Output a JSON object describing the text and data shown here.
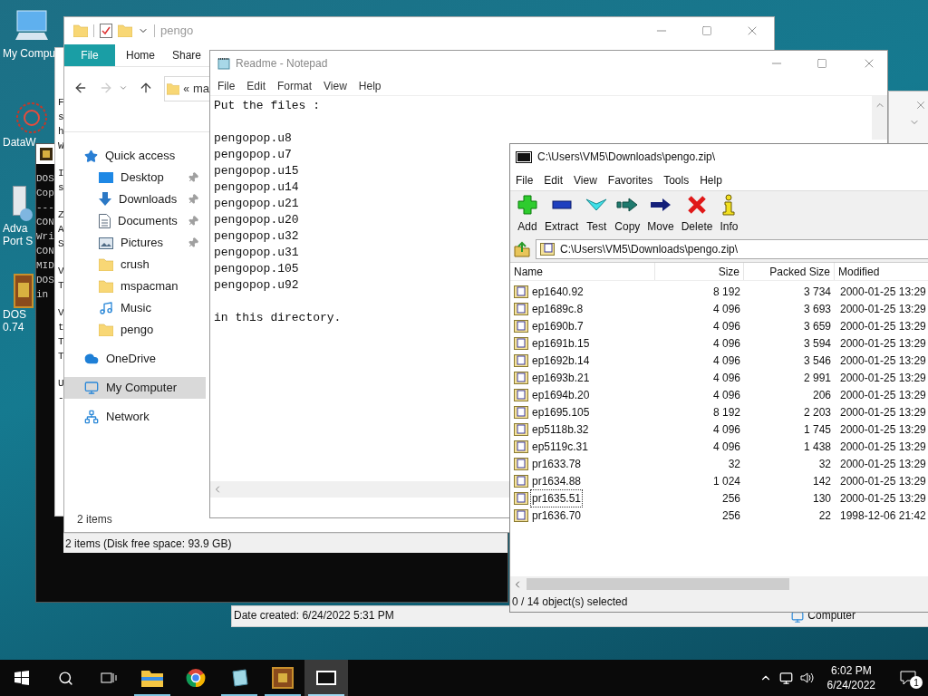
{
  "desktop_icons": [
    {
      "kind": "computer",
      "label_lines": [
        "My Compu"
      ]
    },
    {
      "kind": "molecule-art",
      "label_lines": [
        "DataW"
      ]
    },
    {
      "kind": "server",
      "label_lines": [
        "Adva",
        "Port S"
      ]
    },
    {
      "kind": "dosbox",
      "label_lines": [
        "DOS",
        "0.74"
      ]
    }
  ],
  "dos_window": {
    "lines": [
      "DOS",
      "Cop",
      "---",
      "CON",
      "Wri",
      "CON",
      "MID",
      "DOS",
      "in"
    ]
  },
  "back_text_window": {
    "paragraphs": [
      [
        "F",
        "s",
        "h",
        "W"
      ],
      [
        "I",
        "s"
      ],
      [
        "Z",
        "A",
        "S"
      ],
      [
        "V",
        "T"
      ],
      [
        "V",
        "t",
        "T",
        "T"
      ],
      [
        "U",
        "-"
      ]
    ]
  },
  "explorer": {
    "title": "pengo",
    "tabs": [
      {
        "label": "File",
        "selected": true
      },
      {
        "label": "Home",
        "selected": false
      },
      {
        "label": "Share",
        "selected": false
      }
    ],
    "address_prefix": "«",
    "address": "ma",
    "sidebar": [
      {
        "label": "Quick access",
        "kind": "star",
        "selected": false,
        "children": [
          {
            "label": "Desktop",
            "kind": "desktop",
            "pinned": true,
            "selected": false
          },
          {
            "label": "Downloads",
            "kind": "download",
            "pinned": true,
            "selected": false
          },
          {
            "label": "Documents",
            "kind": "document",
            "pinned": true,
            "selected": false
          },
          {
            "label": "Pictures",
            "kind": "pictures",
            "pinned": true,
            "selected": false
          },
          {
            "label": "crush",
            "kind": "folder",
            "pinned": false,
            "selected": false
          },
          {
            "label": "mspacman",
            "kind": "folder",
            "pinned": false,
            "selected": false
          },
          {
            "label": "Music",
            "kind": "music",
            "pinned": false,
            "selected": false
          },
          {
            "label": "pengo",
            "kind": "folder",
            "pinned": false,
            "selected": false
          }
        ]
      },
      {
        "label": "OneDrive",
        "kind": "cloud",
        "selected": false
      },
      {
        "label": "My Computer",
        "kind": "computer",
        "selected": true
      },
      {
        "label": "Network",
        "kind": "network",
        "selected": false
      }
    ],
    "item_count": "2 items"
  },
  "back_status": "2 items (Disk free space: 93.9 GB)",
  "notepad": {
    "title": "Readme - Notepad",
    "menu": [
      "File",
      "Edit",
      "Format",
      "View",
      "Help"
    ],
    "paragraphs": [
      [
        "Put the files :"
      ],
      [
        "pengopop.u8",
        "pengopop.u7",
        "pengopop.u15",
        "pengopop.u14",
        "pengopop.u21",
        "pengopop.u20",
        "pengopop.u32",
        "pengopop.u31",
        "pengopop.105",
        "pengopop.u92"
      ],
      [
        "in this directory."
      ]
    ]
  },
  "archive": {
    "title": "C:\\Users\\VM5\\Downloads\\pengo.zip\\",
    "menu": [
      "File",
      "Edit",
      "View",
      "Favorites",
      "Tools",
      "Help"
    ],
    "toolbar": [
      {
        "label": "Add",
        "kind": "add"
      },
      {
        "label": "Extract",
        "kind": "extract"
      },
      {
        "label": "Test",
        "kind": "test"
      },
      {
        "label": "Copy",
        "kind": "copy"
      },
      {
        "label": "Move",
        "kind": "move"
      },
      {
        "label": "Delete",
        "kind": "delete"
      },
      {
        "label": "Info",
        "kind": "info"
      }
    ],
    "path": "C:\\Users\\VM5\\Downloads\\pengo.zip\\",
    "columns": [
      "Name",
      "Size",
      "Packed Size",
      "Modified"
    ],
    "rows": [
      {
        "name": "ep1640.92",
        "size": "8 192",
        "packed": "3 734",
        "modified": "2000-01-25 13:29",
        "focused": false
      },
      {
        "name": "ep1689c.8",
        "size": "4 096",
        "packed": "3 693",
        "modified": "2000-01-25 13:29",
        "focused": false
      },
      {
        "name": "ep1690b.7",
        "size": "4 096",
        "packed": "3 659",
        "modified": "2000-01-25 13:29",
        "focused": false
      },
      {
        "name": "ep1691b.15",
        "size": "4 096",
        "packed": "3 594",
        "modified": "2000-01-25 13:29",
        "focused": false
      },
      {
        "name": "ep1692b.14",
        "size": "4 096",
        "packed": "3 546",
        "modified": "2000-01-25 13:29",
        "focused": false
      },
      {
        "name": "ep1693b.21",
        "size": "4 096",
        "packed": "2 991",
        "modified": "2000-01-25 13:29",
        "focused": false
      },
      {
        "name": "ep1694b.20",
        "size": "4 096",
        "packed": "206",
        "modified": "2000-01-25 13:29",
        "focused": false
      },
      {
        "name": "ep1695.105",
        "size": "8 192",
        "packed": "2 203",
        "modified": "2000-01-25 13:29",
        "focused": false
      },
      {
        "name": "ep5118b.32",
        "size": "4 096",
        "packed": "1 745",
        "modified": "2000-01-25 13:29",
        "focused": false
      },
      {
        "name": "ep5119c.31",
        "size": "4 096",
        "packed": "1 438",
        "modified": "2000-01-25 13:29",
        "focused": false
      },
      {
        "name": "pr1633.78",
        "size": "32",
        "packed": "32",
        "modified": "2000-01-25 13:29",
        "focused": false
      },
      {
        "name": "pr1634.88",
        "size": "1 024",
        "packed": "142",
        "modified": "2000-01-25 13:29",
        "focused": false
      },
      {
        "name": "pr1635.51",
        "size": "256",
        "packed": "130",
        "modified": "2000-01-25 13:29",
        "focused": true
      },
      {
        "name": "pr1636.70",
        "size": "256",
        "packed": "22",
        "modified": "1998-12-06 21:42",
        "focused": false
      }
    ],
    "status": "0 / 14 object(s) selected"
  },
  "back_window": {
    "date_created": "Date created: 6/24/2022 5:31 PM",
    "location": "Computer"
  },
  "taskbar": {
    "apps": [
      {
        "kind": "folder",
        "running": true,
        "active": false
      },
      {
        "kind": "chrome",
        "running": false,
        "active": false
      },
      {
        "kind": "notepad",
        "running": true,
        "active": false
      },
      {
        "kind": "dosbox",
        "running": true,
        "active": false
      },
      {
        "kind": "sevenzip",
        "running": true,
        "active": true
      }
    ],
    "time": "6:02 PM",
    "date": "6/24/2022",
    "notifications": "1"
  }
}
